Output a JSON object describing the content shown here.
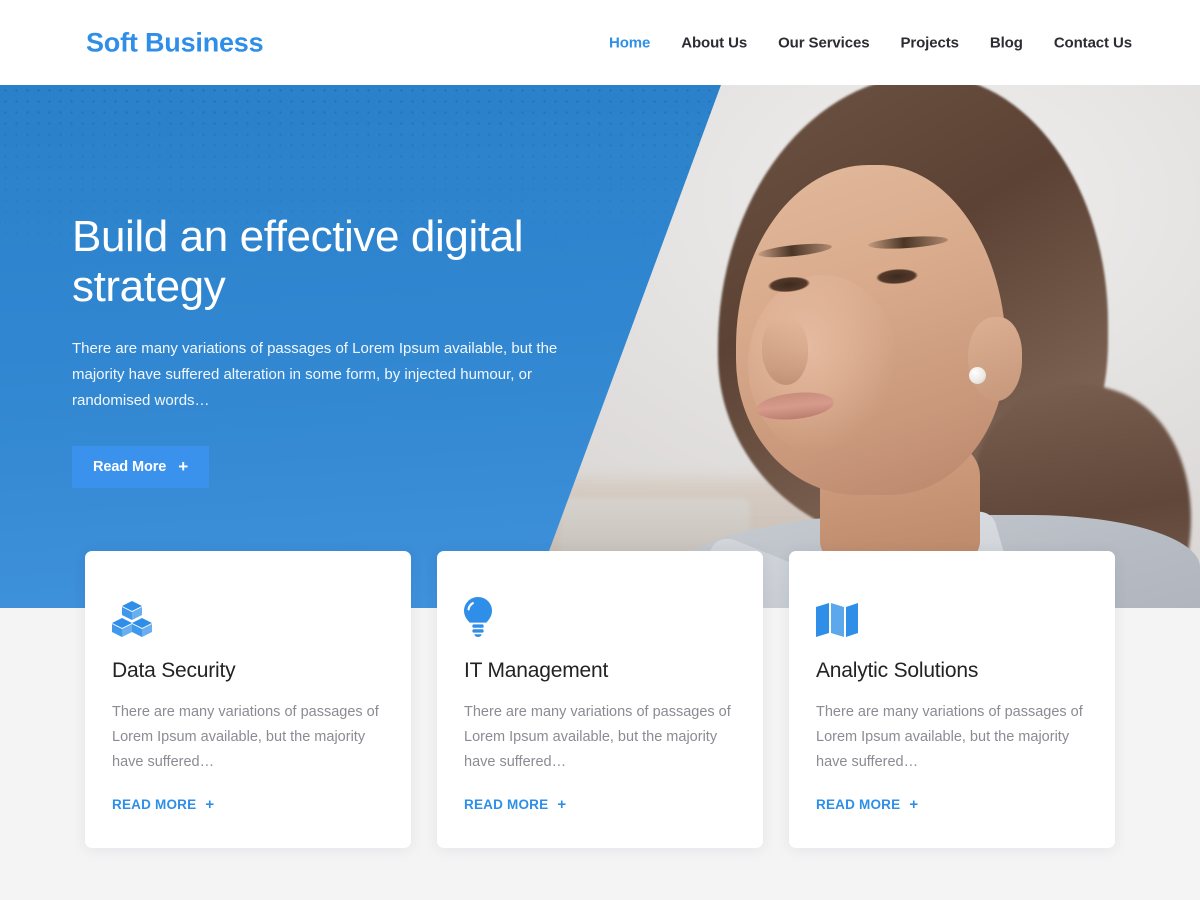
{
  "site": {
    "logo": "Soft Business",
    "accent_color": "#2f8fe8",
    "hero_blue": "#3086d0",
    "page_background": "#f4f4f4"
  },
  "nav": {
    "items": [
      {
        "label": "Home",
        "active": true
      },
      {
        "label": "About Us",
        "active": false
      },
      {
        "label": "Our Services",
        "active": false
      },
      {
        "label": "Projects",
        "active": false
      },
      {
        "label": "Blog",
        "active": false
      },
      {
        "label": "Contact Us",
        "active": false
      }
    ]
  },
  "hero": {
    "title": "Build an effective digital strategy",
    "subtitle": "There are many variations of passages of Lorem Ipsum available, but the majority have suffered alteration in some form, by injected humour, or randomised words…",
    "button_label": "Read More",
    "button_icon": "plus-icon",
    "image_alt": "woman-portrait-photo"
  },
  "cards": [
    {
      "icon": "cubes-icon",
      "title": "Data Security",
      "text": "There are many variations of passages of Lorem Ipsum available, but the majority have suffered…",
      "link_label": "READ MORE",
      "link_icon": "plus-icon"
    },
    {
      "icon": "lightbulb-icon",
      "title": "IT Management",
      "text": "There are many variations of passages of Lorem Ipsum available, but the majority have suffered…",
      "link_label": "READ MORE",
      "link_icon": "plus-icon"
    },
    {
      "icon": "map-icon",
      "title": "Analytic Solutions",
      "text": "There are many variations of passages of Lorem Ipsum available, but the majority have suffered…",
      "link_label": "READ MORE",
      "link_icon": "plus-icon"
    }
  ]
}
